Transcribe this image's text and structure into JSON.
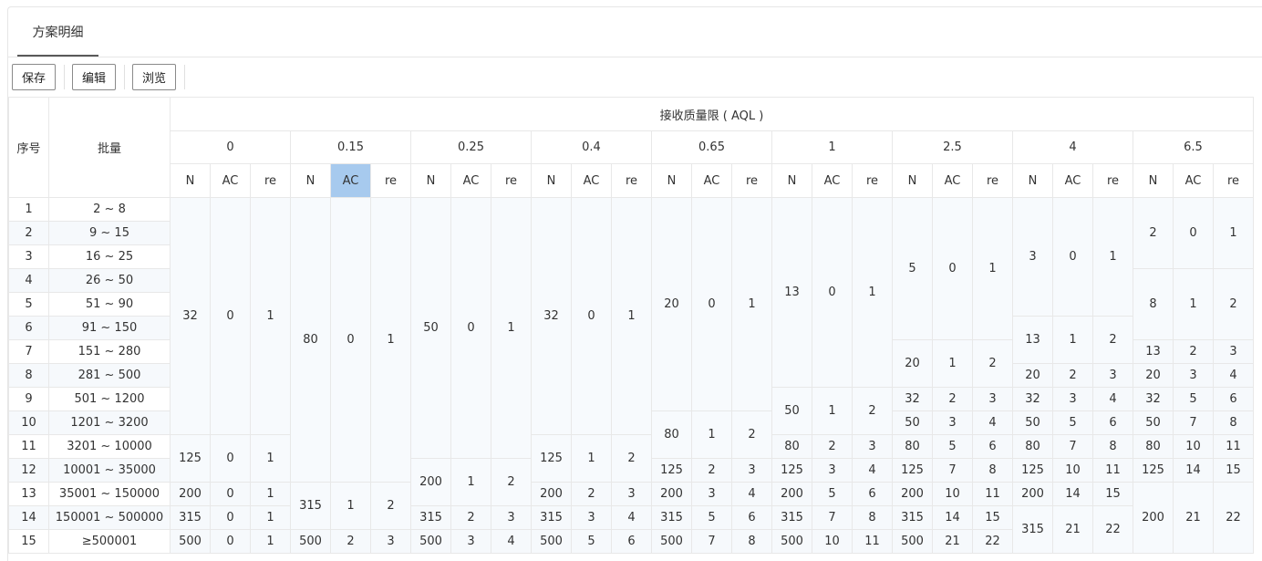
{
  "tabs": [
    {
      "label": "方案明细"
    }
  ],
  "toolbar": {
    "save": "保存",
    "edit": "编辑",
    "browse": "浏览"
  },
  "table": {
    "col_seq": "序号",
    "col_batch": "批量",
    "group_title": "接收质量限 ( AQL )",
    "aql_levels": [
      "0",
      "0.15",
      "0.25",
      "0.4",
      "0.65",
      "1",
      "2.5",
      "4",
      "6.5"
    ],
    "sub_cols": [
      "N",
      "AC",
      "re"
    ],
    "selected_header": {
      "aql_index": 1,
      "sub": "AC"
    },
    "rows": [
      {
        "seq": "1",
        "batch": "2 ~ 8"
      },
      {
        "seq": "2",
        "batch": "9 ~ 15"
      },
      {
        "seq": "3",
        "batch": "16 ~ 25"
      },
      {
        "seq": "4",
        "batch": "26 ~ 50"
      },
      {
        "seq": "5",
        "batch": "51 ~ 90"
      },
      {
        "seq": "6",
        "batch": "91 ~ 150"
      },
      {
        "seq": "7",
        "batch": "151 ~ 280"
      },
      {
        "seq": "8",
        "batch": "281 ~ 500"
      },
      {
        "seq": "9",
        "batch": "501 ~ 1200"
      },
      {
        "seq": "10",
        "batch": "1201 ~ 3200"
      },
      {
        "seq": "11",
        "batch": "3201 ~ 10000"
      },
      {
        "seq": "12",
        "batch": "10001 ~ 35000"
      },
      {
        "seq": "13",
        "batch": "35001 ~ 150000"
      },
      {
        "seq": "14",
        "batch": "150001 ~ 500000"
      },
      {
        "seq": "15",
        "batch": "≥500001"
      }
    ],
    "aql_blocks": [
      [
        {
          "from": 1,
          "to": 10,
          "n": "32",
          "ac": "0",
          "re": "1"
        },
        {
          "from": 11,
          "to": 12,
          "n": "125",
          "ac": "0",
          "re": "1"
        },
        {
          "from": 13,
          "to": 13,
          "n": "200",
          "ac": "0",
          "re": "1"
        },
        {
          "from": 14,
          "to": 14,
          "n": "315",
          "ac": "0",
          "re": "1"
        },
        {
          "from": 15,
          "to": 15,
          "n": "500",
          "ac": "0",
          "re": "1"
        }
      ],
      [
        {
          "from": 1,
          "to": 12,
          "n": "80",
          "ac": "0",
          "re": "1"
        },
        {
          "from": 13,
          "to": 14,
          "n": "315",
          "ac": "1",
          "re": "2"
        },
        {
          "from": 15,
          "to": 15,
          "n": "500",
          "ac": "2",
          "re": "3"
        }
      ],
      [
        {
          "from": 1,
          "to": 11,
          "n": "50",
          "ac": "0",
          "re": "1"
        },
        {
          "from": 12,
          "to": 13,
          "n": "200",
          "ac": "1",
          "re": "2"
        },
        {
          "from": 14,
          "to": 14,
          "n": "315",
          "ac": "2",
          "re": "3"
        },
        {
          "from": 15,
          "to": 15,
          "n": "500",
          "ac": "3",
          "re": "4"
        }
      ],
      [
        {
          "from": 1,
          "to": 10,
          "n": "32",
          "ac": "0",
          "re": "1"
        },
        {
          "from": 11,
          "to": 12,
          "n": "125",
          "ac": "1",
          "re": "2"
        },
        {
          "from": 13,
          "to": 13,
          "n": "200",
          "ac": "2",
          "re": "3"
        },
        {
          "from": 14,
          "to": 14,
          "n": "315",
          "ac": "3",
          "re": "4"
        },
        {
          "from": 15,
          "to": 15,
          "n": "500",
          "ac": "5",
          "re": "6"
        }
      ],
      [
        {
          "from": 1,
          "to": 9,
          "n": "20",
          "ac": "0",
          "re": "1"
        },
        {
          "from": 10,
          "to": 11,
          "n": "80",
          "ac": "1",
          "re": "2"
        },
        {
          "from": 12,
          "to": 12,
          "n": "125",
          "ac": "2",
          "re": "3"
        },
        {
          "from": 13,
          "to": 13,
          "n": "200",
          "ac": "3",
          "re": "4"
        },
        {
          "from": 14,
          "to": 14,
          "n": "315",
          "ac": "5",
          "re": "6"
        },
        {
          "from": 15,
          "to": 15,
          "n": "500",
          "ac": "7",
          "re": "8"
        }
      ],
      [
        {
          "from": 1,
          "to": 8,
          "n": "13",
          "ac": "0",
          "re": "1"
        },
        {
          "from": 9,
          "to": 10,
          "n": "50",
          "ac": "1",
          "re": "2"
        },
        {
          "from": 11,
          "to": 11,
          "n": "80",
          "ac": "2",
          "re": "3"
        },
        {
          "from": 12,
          "to": 12,
          "n": "125",
          "ac": "3",
          "re": "4"
        },
        {
          "from": 13,
          "to": 13,
          "n": "200",
          "ac": "5",
          "re": "6"
        },
        {
          "from": 14,
          "to": 14,
          "n": "315",
          "ac": "7",
          "re": "8"
        },
        {
          "from": 15,
          "to": 15,
          "n": "500",
          "ac": "10",
          "re": "11"
        }
      ],
      [
        {
          "from": 1,
          "to": 6,
          "n": "5",
          "ac": "0",
          "re": "1"
        },
        {
          "from": 7,
          "to": 8,
          "n": "20",
          "ac": "1",
          "re": "2"
        },
        {
          "from": 9,
          "to": 9,
          "n": "32",
          "ac": "2",
          "re": "3"
        },
        {
          "from": 10,
          "to": 10,
          "n": "50",
          "ac": "3",
          "re": "4"
        },
        {
          "from": 11,
          "to": 11,
          "n": "80",
          "ac": "5",
          "re": "6"
        },
        {
          "from": 12,
          "to": 12,
          "n": "125",
          "ac": "7",
          "re": "8"
        },
        {
          "from": 13,
          "to": 13,
          "n": "200",
          "ac": "10",
          "re": "11"
        },
        {
          "from": 14,
          "to": 14,
          "n": "315",
          "ac": "14",
          "re": "15"
        },
        {
          "from": 15,
          "to": 15,
          "n": "500",
          "ac": "21",
          "re": "22"
        }
      ],
      [
        {
          "from": 1,
          "to": 5,
          "n": "3",
          "ac": "0",
          "re": "1"
        },
        {
          "from": 6,
          "to": 7,
          "n": "13",
          "ac": "1",
          "re": "2"
        },
        {
          "from": 8,
          "to": 8,
          "n": "20",
          "ac": "2",
          "re": "3"
        },
        {
          "from": 9,
          "to": 9,
          "n": "32",
          "ac": "3",
          "re": "4"
        },
        {
          "from": 10,
          "to": 10,
          "n": "50",
          "ac": "5",
          "re": "6"
        },
        {
          "from": 11,
          "to": 11,
          "n": "80",
          "ac": "7",
          "re": "8"
        },
        {
          "from": 12,
          "to": 12,
          "n": "125",
          "ac": "10",
          "re": "11"
        },
        {
          "from": 13,
          "to": 13,
          "n": "200",
          "ac": "14",
          "re": "15"
        },
        {
          "from": 14,
          "to": 15,
          "n": "315",
          "ac": "21",
          "re": "22"
        }
      ],
      [
        {
          "from": 1,
          "to": 3,
          "n": "2",
          "ac": "0",
          "re": "1"
        },
        {
          "from": 4,
          "to": 6,
          "n": "8",
          "ac": "1",
          "re": "2"
        },
        {
          "from": 7,
          "to": 7,
          "n": "13",
          "ac": "2",
          "re": "3"
        },
        {
          "from": 8,
          "to": 8,
          "n": "20",
          "ac": "3",
          "re": "4"
        },
        {
          "from": 9,
          "to": 9,
          "n": "32",
          "ac": "5",
          "re": "6"
        },
        {
          "from": 10,
          "to": 10,
          "n": "50",
          "ac": "7",
          "re": "8"
        },
        {
          "from": 11,
          "to": 11,
          "n": "80",
          "ac": "10",
          "re": "11"
        },
        {
          "from": 12,
          "to": 12,
          "n": "125",
          "ac": "14",
          "re": "15"
        },
        {
          "from": 13,
          "to": 15,
          "n": "200",
          "ac": "21",
          "re": "22"
        }
      ]
    ]
  }
}
